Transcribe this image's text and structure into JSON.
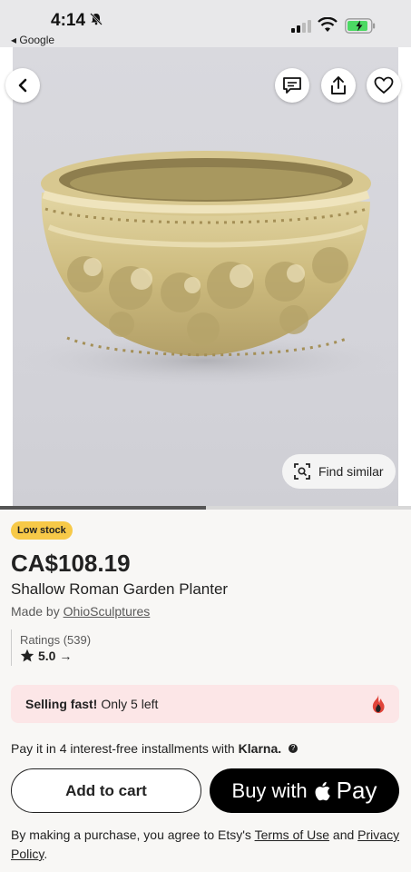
{
  "status_bar": {
    "time": "4:14",
    "back_app": "Google"
  },
  "product": {
    "badge": "Low stock",
    "price": "CA$108.19",
    "title": "Shallow Roman Garden Planter",
    "made_by_prefix": "Made by ",
    "seller": "OhioSculptures",
    "ratings_label": "Ratings (539)",
    "rating_value": "5.0 →",
    "selling_fast_bold": "Selling fast!",
    "selling_fast_rest": "Only 5 left"
  },
  "image": {
    "find_similar": "Find similar",
    "carousel_progress": 0.5
  },
  "payment": {
    "installments": "Pay it in 4 interest-free installments with",
    "klarna": "Klarna.",
    "add_to_cart": "Add to cart",
    "buy_with": "Buy with",
    "pay": "Pay"
  },
  "legal": {
    "text_before": "By making a purchase, you agree to Etsy's ",
    "terms": "Terms of Use",
    "and": " and ",
    "privacy": "Privacy Policy",
    "period": "."
  },
  "icons": [
    "bell-slash-icon",
    "signal-icon",
    "wifi-icon",
    "battery-icon",
    "back-arrow-icon",
    "message-icon",
    "share-icon",
    "heart-icon",
    "scan-icon",
    "star-icon",
    "flame-icon",
    "info-icon",
    "apple-icon"
  ],
  "colors": {
    "badge": "#f7c948",
    "selling_bg": "#fce6e7",
    "battery": "#4cd964"
  }
}
